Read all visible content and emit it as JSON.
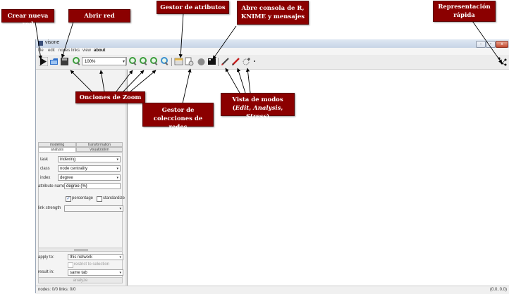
{
  "window": {
    "title": "visone",
    "minimize": "-",
    "maximize": "▫",
    "close": "x"
  },
  "menu": [
    "file",
    "edit",
    "nodes",
    "links",
    "view",
    "about"
  ],
  "toolbar": {
    "zoom_value": "100%",
    "icons": [
      "new-network-icon",
      "open-network-icon",
      "save-icon",
      "zoom-icon",
      "zoom-in-icon",
      "zoom-out-icon",
      "zoom-fit-icon",
      "zoom-area-icon",
      "attribute-manager-icon",
      "network-collection-icon",
      "r-console-icon",
      "terminal-icon",
      "edit-mode-icon",
      "analysis-mode-icon",
      "stress-mode-icon",
      "quick-layout-icon"
    ]
  },
  "left_panel": {
    "tabs_back": [
      "modeling",
      "transformation"
    ],
    "tabs_front": [
      "analysis",
      "visualization"
    ],
    "task_label": "task",
    "task_value": "indexing",
    "class_label": "class",
    "class_value": "node centrality",
    "index_label": "index",
    "index_value": "degree",
    "attribute_name_label": "attribute name",
    "attribute_name_value": "degree (%)",
    "percentage_label": "percentage",
    "percentage_checked": "✓",
    "standardize_label": "standardize",
    "link_strength_label": "link strength",
    "apply_to_label": "apply to:",
    "apply_to_value": "this network",
    "restrict_label": "restrict to selection",
    "result_in_label": "result in:",
    "result_in_value": "same tab",
    "analyze_label": "analyze"
  },
  "status": {
    "counts": "nodes: 0/0  links: 0/0",
    "coords": "(0.0, 0.0)"
  },
  "callouts": {
    "crear": "Crear nueva red",
    "abrir": "Abrir red",
    "gestor_atributos": "Gestor de atributos",
    "consola_line1": "Abre consola de R,",
    "consola_line2": "KNIME y mensajes",
    "representacion_line1": "Representación",
    "representacion_line2": "rápida",
    "zoom": "Onciones de Zoom",
    "colecciones_line1": "Gestor de",
    "colecciones_line2": "colecciones de redes",
    "modos_prefix": "Vista de modos (",
    "modos_edit": "Edit",
    "modos_sep1": ", ",
    "modos_analysis": "Analysis",
    "modos_sep2": ", ",
    "modos_stress": "Stress",
    "modos_suffix": ")"
  },
  "colors": {
    "callout_bg": "#8b0000",
    "zoom_green": "#3b9d3b"
  }
}
